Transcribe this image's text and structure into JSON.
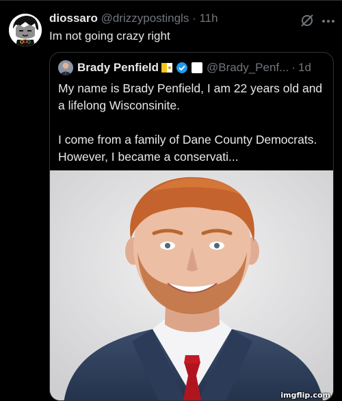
{
  "tweet": {
    "author_name": "diossaro",
    "author_handle": "@drizzypostingls",
    "separator": "·",
    "time": "11h",
    "text": "Im not going crazy right"
  },
  "quoted_tweet": {
    "author_name": "Brady Penfield",
    "author_handle": "@Brady_Penf...",
    "separator": "·",
    "time": "1d",
    "paragraph_1": "My name is Brady Penfield, I am 22 years old and a lifelong Wisconsinite.",
    "paragraph_2": "I come from a family of Dane County Democrats. However, I became a conservati..."
  },
  "watermark": "imgflip.com",
  "icons": {
    "grok": "grok-slash-icon",
    "more": "more-dots-icon",
    "verified": "verified-badge-icon",
    "flag": "vatican-flag-icon",
    "affiliation": "crescent-badge-icon"
  },
  "colors": {
    "background": "#000000",
    "text_primary": "#e7e9ea",
    "text_secondary": "#71767b",
    "border": "#2f3336",
    "verified_blue": "#1d9bf0"
  }
}
